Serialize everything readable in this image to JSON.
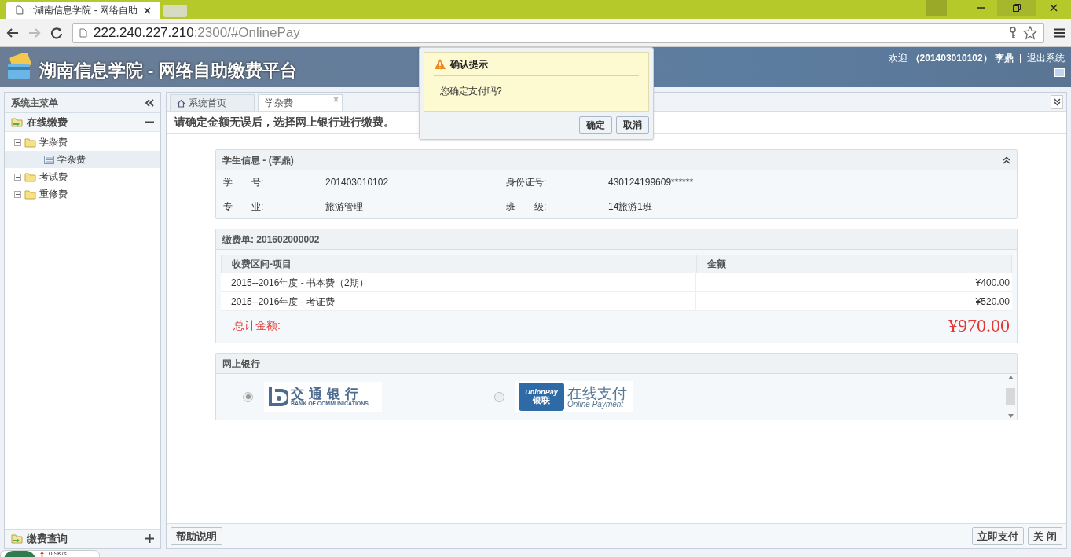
{
  "browser": {
    "tab_title": "::湖南信息学院 - 网络自助",
    "url_host": "222.240.227.210",
    "url_rest": ":2300/#OnlinePay"
  },
  "header": {
    "title": "湖南信息学院 - 网络自助缴费平台",
    "welcome": "欢迎",
    "user_id": "（201403010102）",
    "user_name": "李鼎",
    "logout": "退出系统"
  },
  "sidebar": {
    "title": "系统主菜单",
    "sections": [
      {
        "label": "在线缴费",
        "expanded": true,
        "items": [
          {
            "label": "学杂费",
            "expanded": true,
            "children": [
              {
                "label": "学杂费",
                "selected": true
              }
            ]
          },
          {
            "label": "考试费",
            "expanded": true
          },
          {
            "label": "重修费",
            "expanded": true
          }
        ]
      },
      {
        "label": "缴费查询",
        "expanded": false
      }
    ]
  },
  "tabs": [
    {
      "label": "系统首页",
      "kind": "home",
      "selected": false
    },
    {
      "label": "学杂费",
      "kind": "closable",
      "selected": true
    }
  ],
  "notice": "请确定金额无误后，选择网上银行进行缴费。",
  "student": {
    "title": "学生信息 - (李鼎)",
    "fields": [
      {
        "label": "学　　号:",
        "value": "201403010102"
      },
      {
        "label": "身份证号:",
        "value": "430124199609******"
      },
      {
        "label": "专　　业:",
        "value": "旅游管理"
      },
      {
        "label": "班　　级:",
        "value": "14旅游1班"
      }
    ]
  },
  "bill": {
    "title": "缴费单: 201602000002",
    "columns": [
      "收费区间-项目",
      "金额"
    ],
    "rows": [
      {
        "item": "2015--2016年度 - 书本费（2期）",
        "amount": "¥400.00"
      },
      {
        "item": "2015--2016年度 - 考证费",
        "amount": "¥520.00"
      }
    ],
    "total_label": "总计金额:",
    "total": "¥970.00"
  },
  "banks": {
    "title": "网上银行",
    "options": [
      {
        "kind": "bocom",
        "selected": true,
        "name": "交通银行",
        "subtitle": "BANK OF COMMUNICATIONS"
      },
      {
        "kind": "unionpay",
        "selected": false,
        "badge_top": "UnionPay",
        "badge_bottom": "银联",
        "name": "在线支付",
        "subtitle": "Online Payment"
      }
    ]
  },
  "footer": {
    "help": "帮助说明",
    "pay": "立即支付",
    "close": "关 闭"
  },
  "dialog": {
    "title": "确认提示",
    "message": "您确定支付吗?",
    "buttons": [
      "确定",
      "取消"
    ]
  },
  "speed_widget": {
    "speed": "0.9K/s"
  }
}
